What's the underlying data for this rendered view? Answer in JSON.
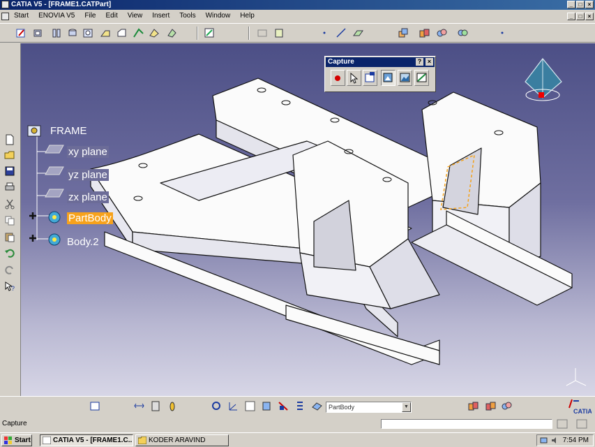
{
  "window": {
    "title": "CATIA V5 - [FRAME1.CATPart]",
    "controls": [
      "_",
      "□",
      "×"
    ]
  },
  "menubar": {
    "items": [
      "Start",
      "ENOVIA V5",
      "File",
      "Edit",
      "View",
      "Insert",
      "Tools",
      "Window",
      "Help"
    ]
  },
  "tree": {
    "root": "FRAME",
    "planes": [
      "xy plane",
      "yz plane",
      "zx plane"
    ],
    "bodies": [
      "PartBody",
      "Body.2"
    ]
  },
  "capture_toolbar": {
    "title": "Capture",
    "help": "?",
    "close": "×"
  },
  "bottom_toolbar": {
    "body_select": "PartBody"
  },
  "status": {
    "text": "Capture"
  },
  "taskbar": {
    "start": "Start",
    "tasks": [
      "CATIA V5 - [FRAME1.C...",
      "KODER ARAVIND"
    ],
    "arrows": "«",
    "clock": "7:54 PM"
  },
  "brand": {
    "logo": "CATIA"
  },
  "colors": {
    "selection": "#f7a21b",
    "titlebar": "#0a246a",
    "viewport_top": "#4c4f86",
    "viewport_bottom": "#d7d6e6"
  }
}
